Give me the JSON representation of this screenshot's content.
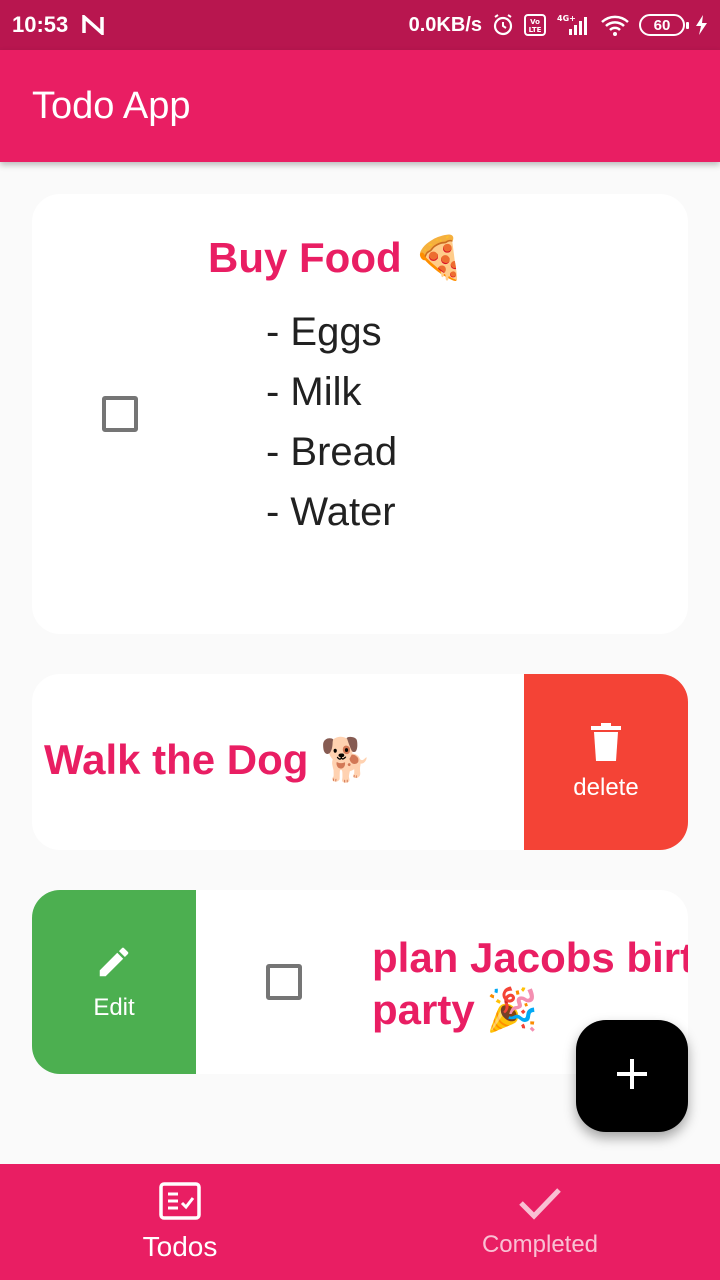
{
  "status_bar": {
    "time": "10:53",
    "network_speed": "0.0KB/s",
    "battery_level": "60",
    "volte_label": "Vo LTE",
    "signal_label": "4G+"
  },
  "app_bar": {
    "title": "Todo App"
  },
  "todos": [
    {
      "title": "Buy Food 🍕",
      "body_lines": [
        "- Eggs",
        "- Milk",
        "- Bread",
        "- Water"
      ],
      "checked": false
    },
    {
      "title": "Walk the Dog 🐕",
      "swipe_action": "delete"
    },
    {
      "title_line1": "plan Jacobs birt",
      "title_line2": "party 🎉",
      "checked": false,
      "swipe_action": "Edit"
    }
  ],
  "fab": {
    "icon": "plus-icon"
  },
  "bottom_nav": {
    "items": [
      {
        "label": "Todos",
        "icon": "todo-list-icon",
        "active": true
      },
      {
        "label": "Completed",
        "icon": "check-icon",
        "active": false
      }
    ]
  },
  "colors": {
    "primary": "#e91e63",
    "status_bar": "#b8164f",
    "delete": "#f44336",
    "edit": "#4caf50",
    "fab": "#000000"
  }
}
